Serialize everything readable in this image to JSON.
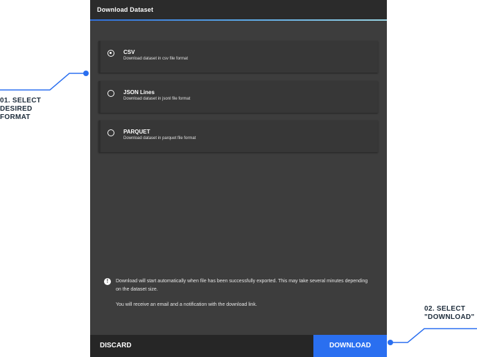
{
  "dialog": {
    "title": "Download Dataset",
    "options": [
      {
        "label": "CSV",
        "description": "Download dataset in csv file format",
        "selected": true
      },
      {
        "label": "JSON Lines",
        "description": "Download dataset in jsonl file format",
        "selected": false
      },
      {
        "label": "PARQUET",
        "description": "Download dataset in parquet file format",
        "selected": false
      }
    ],
    "notice_icon": "info-icon",
    "notice_text": "Download will start automatically when file has been successfully exported. This may take several minutes depending on the dataset size.",
    "notice_email": "You will receive an email and a notification with the download link.",
    "discard_label": "DISCARD",
    "download_label": "DOWNLOAD"
  },
  "callouts": {
    "step1": [
      "01. SELECT",
      "DESIRED",
      "FORMAT"
    ],
    "step2": [
      "02. SELECT",
      "\"DOWNLOAD\""
    ]
  },
  "colors": {
    "accent": "#2a6ff0",
    "callout_line": "#2a6ff0",
    "dialog_bg": "#3d3d3d"
  }
}
